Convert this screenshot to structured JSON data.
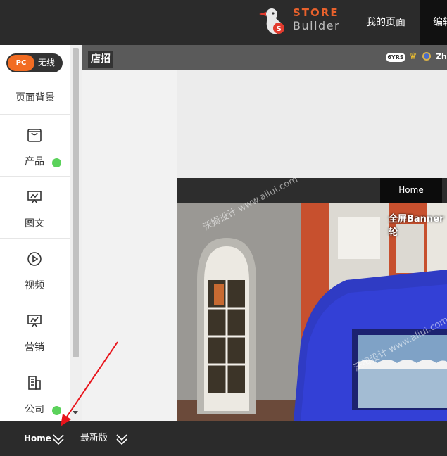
{
  "topbar": {
    "brand_store": "STORE",
    "brand_builder": "Builder",
    "nav": {
      "my_page": "我的页面",
      "edit": "编辑"
    }
  },
  "sidebar": {
    "toggle": {
      "pc": "PC",
      "wireless": "无线"
    },
    "page_background": "页面背景",
    "items": [
      {
        "label": "产品",
        "icon": "bag-icon",
        "has_dot": true
      },
      {
        "label": "图文",
        "icon": "presentation-icon",
        "has_dot": false
      },
      {
        "label": "视频",
        "icon": "play-icon",
        "has_dot": false
      },
      {
        "label": "营销",
        "icon": "presentation-icon",
        "has_dot": false
      },
      {
        "label": "公司",
        "icon": "building-icon",
        "has_dot": true
      }
    ]
  },
  "canvas": {
    "shop_tag": "店招",
    "years_badge": "6YRS",
    "shop_name": "Zhe",
    "nav_home": "Home",
    "banner_title": "全屏Banner轮",
    "watermark": "沃姆设计 www.aliui.com"
  },
  "bottombar": {
    "page": "Home",
    "version": "最新版"
  },
  "colors": {
    "accent": "#f26c22",
    "dot": "#5bd25b",
    "topbar": "#2b2b2b",
    "arrow": "#e8141b"
  }
}
